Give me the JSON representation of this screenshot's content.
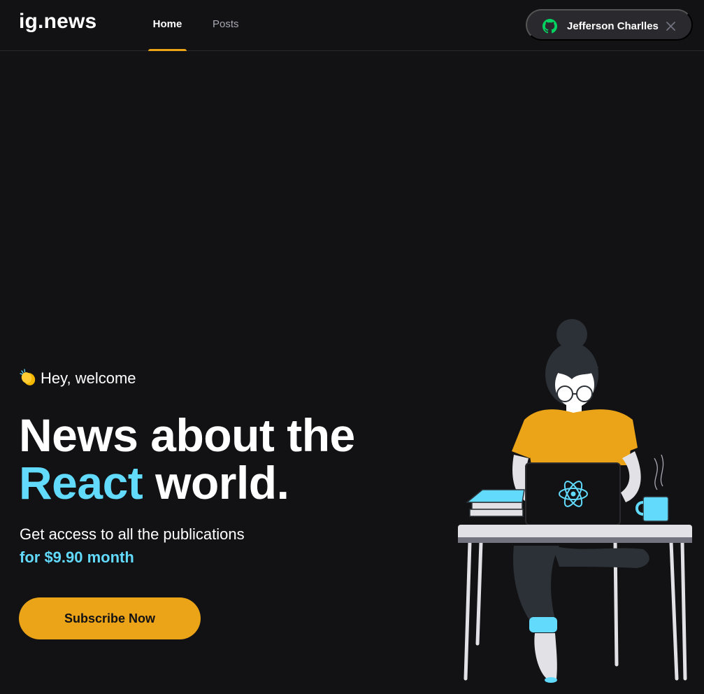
{
  "header": {
    "logo": "ig.news",
    "nav": [
      {
        "label": "Home",
        "active": true
      },
      {
        "label": "Posts",
        "active": false
      }
    ],
    "user": {
      "name": "Jefferson Charlles",
      "icon": "github-icon",
      "close_icon": "close-icon"
    }
  },
  "hero": {
    "welcome_icon": "clapping-hands-icon",
    "welcome": "Hey, welcome",
    "title_line1": "News about the",
    "title_accent": "React",
    "title_rest": "world.",
    "subtitle": "Get access to all the publications",
    "price": "for $9.90 month",
    "cta": "Subscribe Now"
  },
  "colors": {
    "background": "#121214",
    "accent_yellow": "#eba417",
    "accent_cyan": "#61dafb",
    "surface": "#29292e"
  }
}
